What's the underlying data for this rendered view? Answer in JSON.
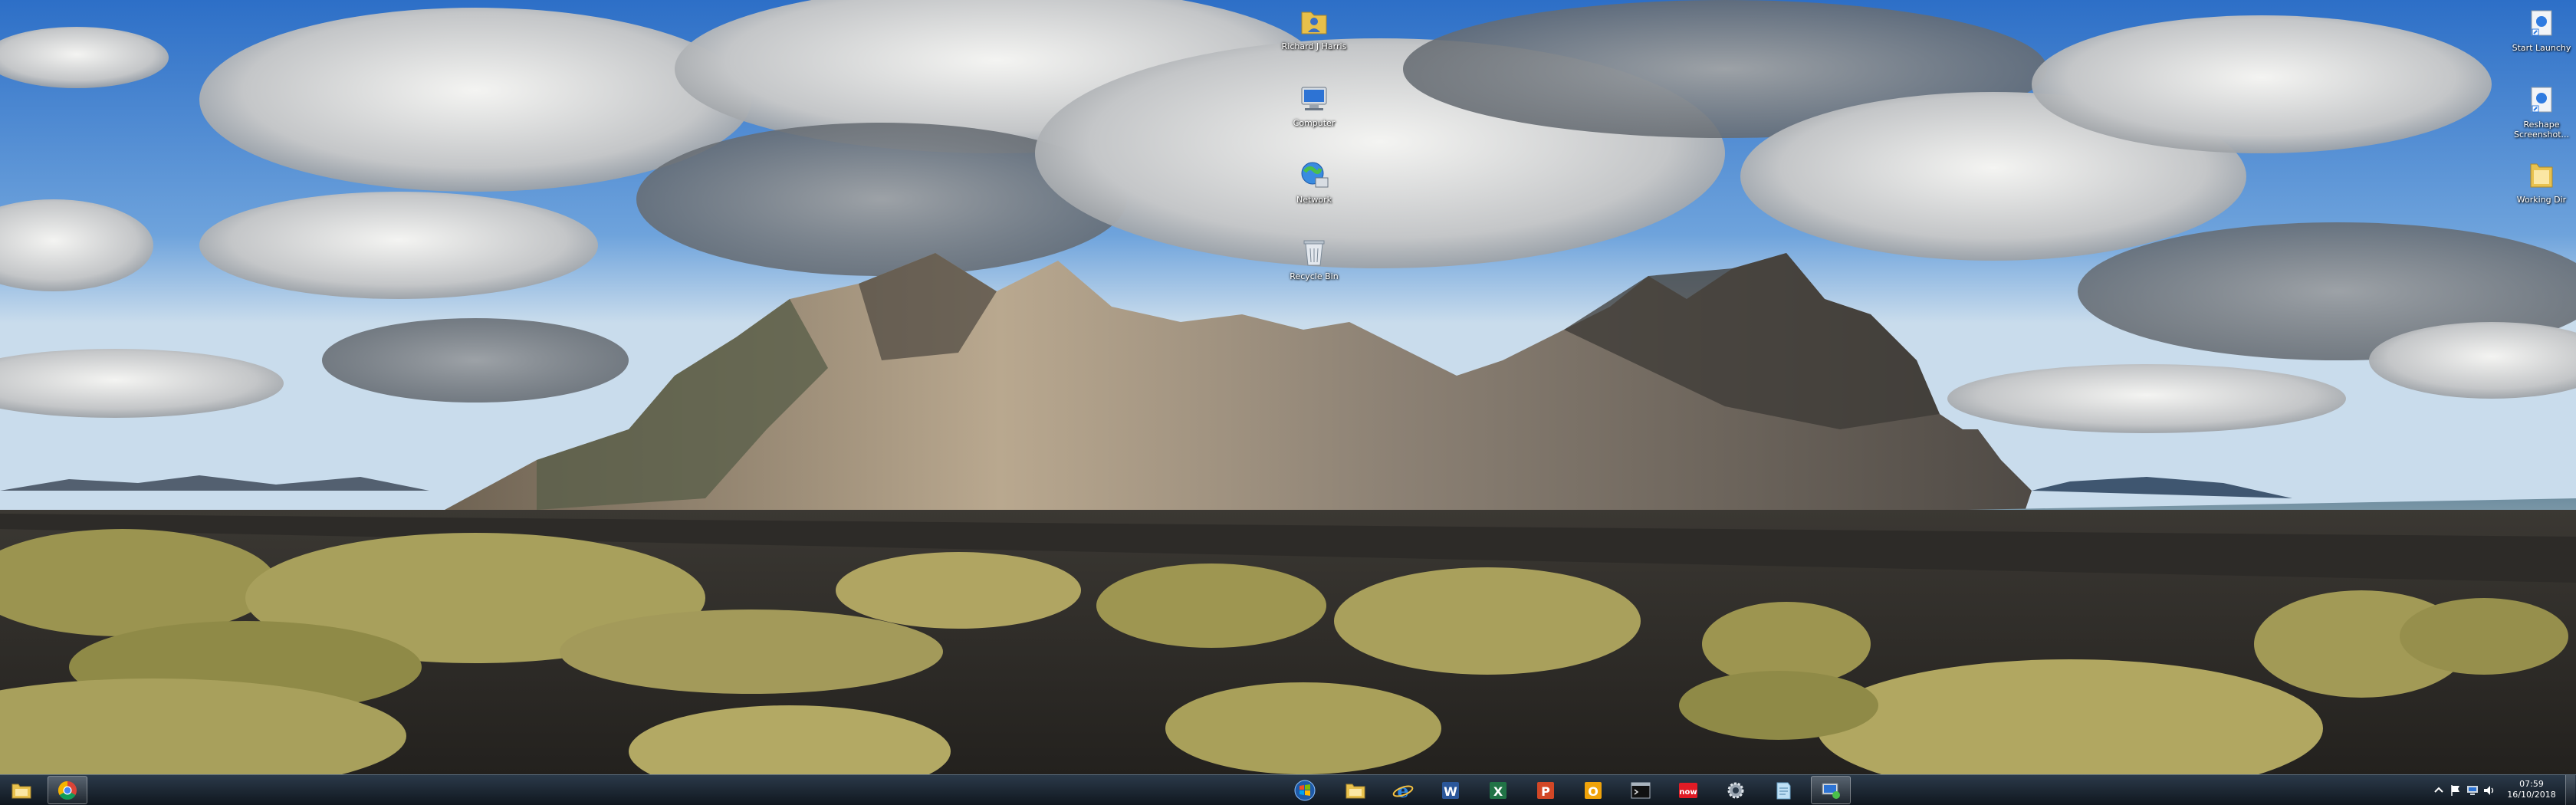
{
  "desktop": {
    "icons_left": [
      {
        "label": "Richard J Harris",
        "icon": "user-folder-icon"
      },
      {
        "label": "Computer",
        "icon": "computer-icon"
      },
      {
        "label": "Network",
        "icon": "network-icon"
      },
      {
        "label": "Recycle Bin",
        "icon": "recycle-bin-icon"
      }
    ],
    "icons_right": [
      {
        "label": "Start Launchy",
        "icon": "shortcut-icon"
      },
      {
        "label": "Reshape Screenshot...",
        "icon": "shortcut-icon"
      },
      {
        "label": "Working Dir",
        "icon": "folder-icon"
      }
    ]
  },
  "taskbar": {
    "left_buttons": [
      {
        "name": "explorer-taskbar-button",
        "icon": "folder-icon"
      },
      {
        "name": "chrome-taskbar-button",
        "icon": "chrome-icon"
      }
    ],
    "center_buttons": [
      {
        "name": "start-button",
        "icon": "windows-orb-icon"
      },
      {
        "name": "explorer-taskbar-button",
        "icon": "folder-icon"
      },
      {
        "name": "ie-taskbar-button",
        "icon": "internet-explorer-icon"
      },
      {
        "name": "word-taskbar-button",
        "icon": "word-icon"
      },
      {
        "name": "excel-taskbar-button",
        "icon": "excel-icon"
      },
      {
        "name": "powerpoint-taskbar-button",
        "icon": "powerpoint-icon"
      },
      {
        "name": "outlook-taskbar-button",
        "icon": "outlook-icon"
      },
      {
        "name": "terminal-taskbar-button",
        "icon": "terminal-icon"
      },
      {
        "name": "now-taskbar-button",
        "icon": "now-icon",
        "label": "now"
      },
      {
        "name": "settings-taskbar-button",
        "icon": "gear-icon"
      },
      {
        "name": "notes-taskbar-button",
        "icon": "notepad-icon"
      },
      {
        "name": "remote-desktop-taskbar-button",
        "icon": "remote-desktop-icon"
      }
    ],
    "tray": {
      "icons": [
        "chevron-up-icon",
        "flag-icon",
        "network-tray-icon",
        "volume-icon"
      ],
      "time": "07:59",
      "date": "16/10/2018"
    }
  },
  "colors": {
    "taskbar_top": "#2b3a4a",
    "taskbar_bottom": "#10171f",
    "sky": "#3d78c4"
  }
}
